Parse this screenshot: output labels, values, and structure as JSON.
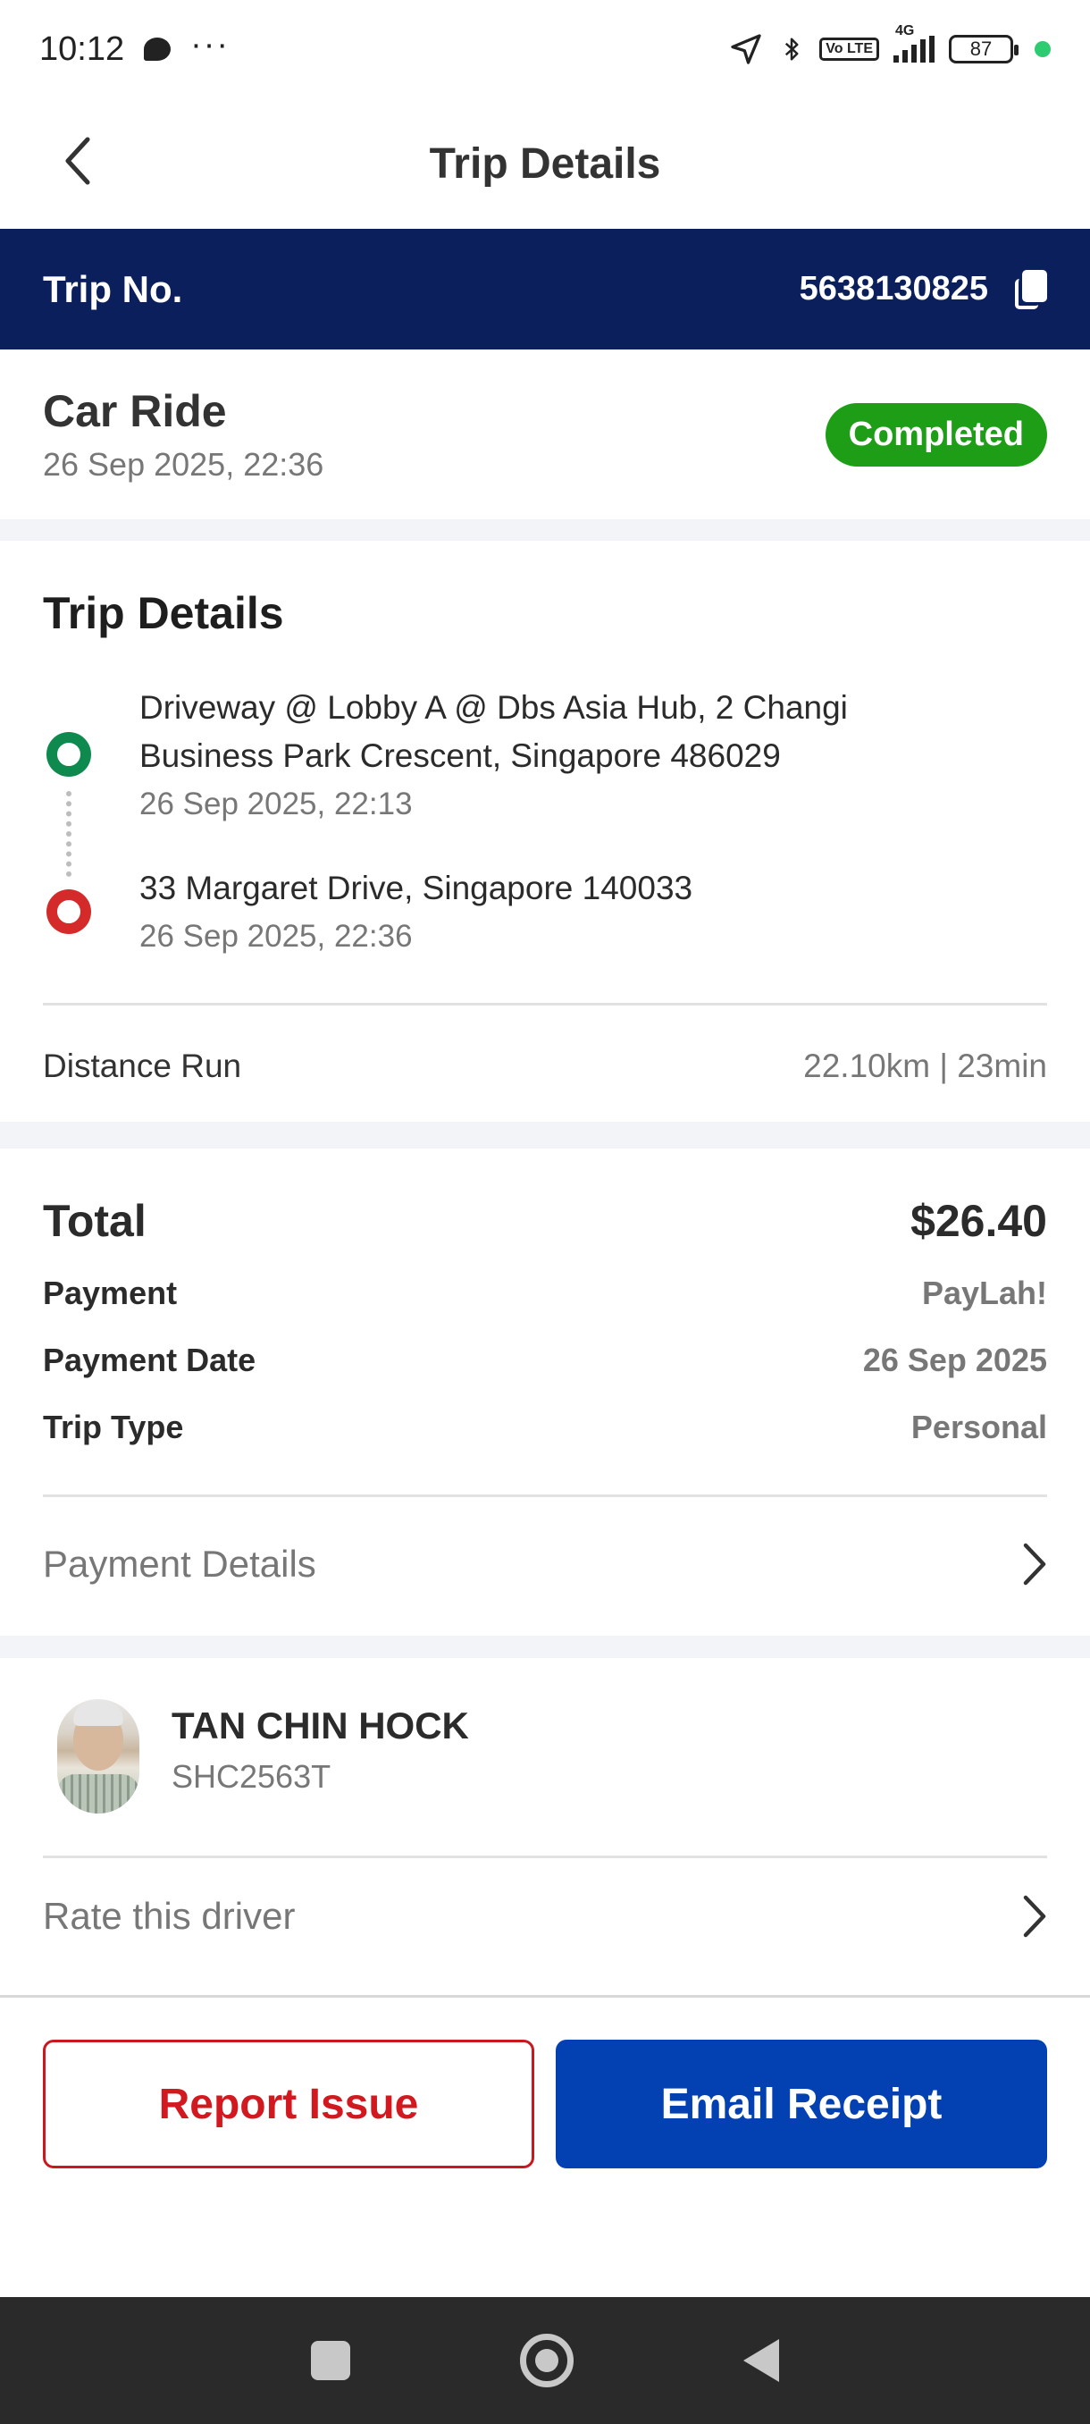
{
  "status_bar": {
    "time": "10:12",
    "dots": "···",
    "network": "4G",
    "volte": "Vo LTE",
    "battery": "87"
  },
  "header": {
    "title": "Trip Details"
  },
  "trip_no": {
    "label": "Trip No.",
    "value": "5638130825"
  },
  "ride": {
    "title": "Car Ride",
    "datetime": "26 Sep 2025, 22:36",
    "status": "Completed"
  },
  "details": {
    "title": "Trip Details",
    "pickup": {
      "address": "Driveway @ Lobby A @ Dbs Asia Hub, 2 Changi Business Park Crescent, Singapore 486029",
      "time": "26 Sep 2025, 22:13"
    },
    "dropoff": {
      "address": "33 Margaret Drive, Singapore 140033",
      "time": "26 Sep 2025, 22:36"
    },
    "distance_label": "Distance Run",
    "distance_value": "22.10km | 23min"
  },
  "payment": {
    "total_label": "Total",
    "total_value": "$26.40",
    "rows": [
      {
        "label": "Payment",
        "value": "PayLah!"
      },
      {
        "label": "Payment Date",
        "value": "26 Sep 2025"
      },
      {
        "label": "Trip Type",
        "value": "Personal"
      }
    ],
    "details_link": "Payment Details"
  },
  "driver": {
    "name": "TAN CHIN HOCK",
    "plate": "SHC2563T",
    "rate_link": "Rate this driver"
  },
  "actions": {
    "report": "Report Issue",
    "email": "Email Receipt"
  },
  "colors": {
    "brand_navy": "#0b1f5c",
    "primary_blue": "#0341b3",
    "completed_green": "#1e9e16",
    "report_red": "#d21920",
    "pickup_green": "#0e8a4e",
    "dropoff_red": "#d42a2a"
  }
}
